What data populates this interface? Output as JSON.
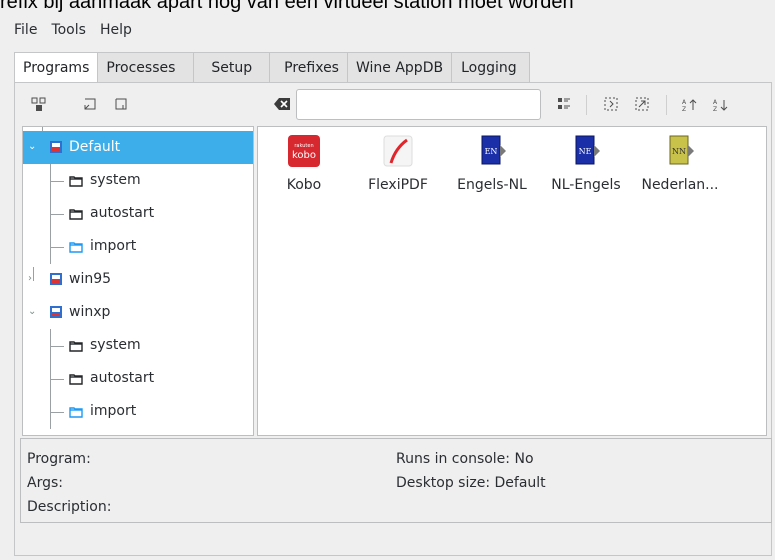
{
  "caption": "refix bij aanmaak apart nog van een virtueel station moet worden",
  "menu": [
    "File",
    "Tools",
    "Help"
  ],
  "tabs": [
    "Programs",
    "Processes",
    "Setup",
    "Prefixes",
    "Wine AppDB",
    "Logging"
  ],
  "active_tab": "Programs",
  "search": {
    "value": "",
    "placeholder": ""
  },
  "tree": {
    "default": "Default",
    "default_system": "system",
    "default_autostart": "autostart",
    "default_import": "import",
    "win95": "win95",
    "winxp": "winxp",
    "winxp_system": "system",
    "winxp_autostart": "autostart",
    "winxp_import": "import"
  },
  "programs": [
    {
      "name": "Kobo",
      "icon": "kobo-icon"
    },
    {
      "name": "FlexiPDF",
      "icon": "flexipdf-icon"
    },
    {
      "name": "Engels-NL",
      "icon": "book-en-icon"
    },
    {
      "name": "NL-Engels",
      "icon": "book-ne-icon"
    },
    {
      "name": "Nederlan...",
      "icon": "book-nn-icon"
    }
  ],
  "info": {
    "program": "Program:",
    "args": "Args:",
    "description": "Description:",
    "runs_in_console": "Runs in console: No",
    "desktop_size": "Desktop size: Default"
  },
  "colors": {
    "selection": "#3daee9",
    "kobo": "#d7282f"
  }
}
